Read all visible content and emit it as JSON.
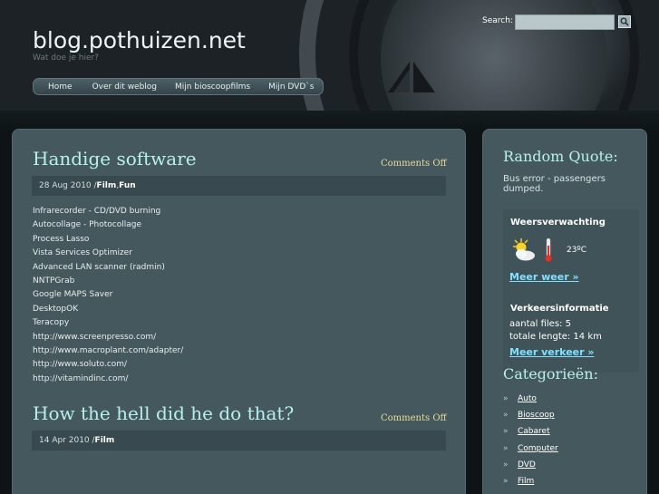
{
  "header": {
    "site_title": "blog.pothuizen.net",
    "tagline": "Wat doe je hier?",
    "search_label": "Search:",
    "search_value": ""
  },
  "nav": {
    "items": [
      "Home",
      "Over dit weblog",
      "Mijn bioscoopfilms",
      "Mijn DVD`s"
    ]
  },
  "posts": [
    {
      "title": "Handige software",
      "comments": "Comments Off",
      "date": "28 Aug 2010 / ",
      "cat1": "Film",
      "sep": ", ",
      "cat2": "Fun",
      "items": [
        "Infrarecorder - CD/DVD burning",
        "Autocollage - Photocollage",
        "Process Lasso",
        "Vista Services Optimizer",
        "Advanced LAN scanner (radmin)",
        "NNTPGrab",
        "Google MAPS Saver",
        "DesktopOK",
        "Teracopy",
        "http://www.screenpresso.com/",
        "http://www.macroplant.com/adapter/",
        "http://www.soluto.com/",
        "http://vitamindinc.com/"
      ]
    },
    {
      "title": "How the hell did he do that?",
      "comments": "Comments Off",
      "date": "14 Apr 2010 / ",
      "cat1": "Film"
    }
  ],
  "sidebar": {
    "quote_heading": "Random Quote:",
    "quote_text": "Bus error - passengers dumped.",
    "weather_title": "Weersverwachting",
    "temperature": "23ºC",
    "weather_link": "Meer weer »",
    "traffic_title": "Verkeersinformatie",
    "traffic_files": "aantal files: 5",
    "traffic_length": "totale lengte: 14 km",
    "traffic_link": "Meer verkeer »",
    "categories_heading": "Categorieën:",
    "categories": [
      "Auto",
      "Bioscoop",
      "Cabaret",
      "Computer",
      "DVD",
      "Film"
    ]
  },
  "colors": {
    "panel": "#45585d",
    "heading": "#b6f0ec",
    "comments": "#e7dc9a",
    "link": "#7fe0ff"
  },
  "icons": {
    "weather": "sun-cloud-icon",
    "thermometer": "thermometer-icon",
    "search": "magnifier-icon"
  }
}
